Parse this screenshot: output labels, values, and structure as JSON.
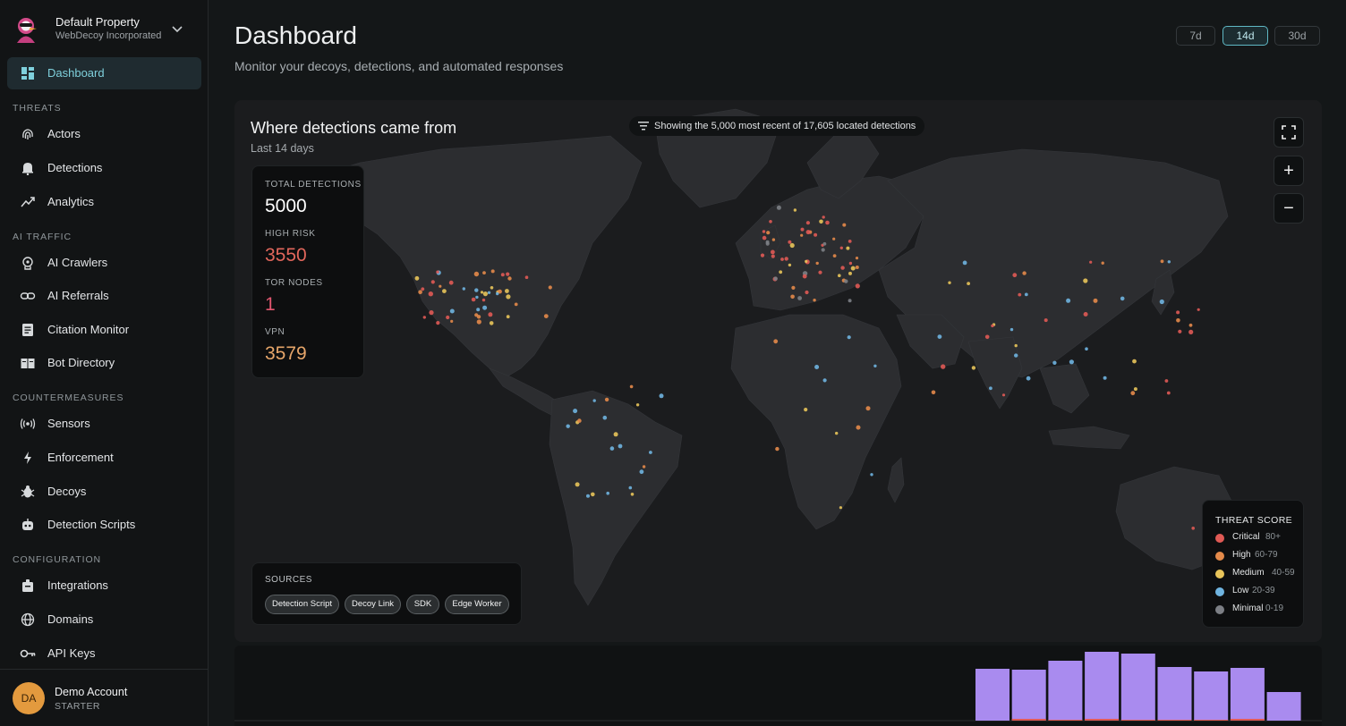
{
  "property": {
    "name": "Default Property",
    "org": "WebDecoy Incorporated"
  },
  "nav": {
    "dashboard": "Dashboard",
    "sections": {
      "threats": "THREATS",
      "ai_traffic": "AI TRAFFIC",
      "countermeasures": "COUNTERMEASURES",
      "configuration": "CONFIGURATION"
    },
    "items": {
      "actors": "Actors",
      "detections": "Detections",
      "analytics": "Analytics",
      "ai_crawlers": "AI Crawlers",
      "ai_referrals": "AI Referrals",
      "citation_monitor": "Citation Monitor",
      "bot_directory": "Bot Directory",
      "sensors": "Sensors",
      "enforcement": "Enforcement",
      "decoys": "Decoys",
      "detection_scripts": "Detection Scripts",
      "integrations": "Integrations",
      "domains": "Domains",
      "api_keys": "API Keys"
    }
  },
  "account": {
    "initials": "DA",
    "name": "Demo Account",
    "plan": "STARTER"
  },
  "header": {
    "title": "Dashboard",
    "subtitle": "Monitor your decoys, detections, and automated responses",
    "ranges": [
      "7d",
      "14d",
      "30d"
    ],
    "selected_range": "14d"
  },
  "map": {
    "title": "Where detections came from",
    "period": "Last 14 days",
    "showing": "Showing the 5,000 most recent of 17,605 located detections",
    "stats": {
      "total_label": "TOTAL DETECTIONS",
      "total": "5000",
      "high_risk_label": "HIGH RISK",
      "high_risk": "3550",
      "tor_label": "TOR NODES",
      "tor": "1",
      "vpn_label": "VPN",
      "vpn": "3579"
    },
    "sources": {
      "title": "SOURCES",
      "chips": [
        "Detection Script",
        "Decoy Link",
        "SDK",
        "Edge Worker"
      ]
    },
    "legend": {
      "title": "THREAT SCORE",
      "items": [
        {
          "name": "Critical",
          "range": "80+",
          "color": "#e05a55"
        },
        {
          "name": "High",
          "range": "60-79",
          "color": "#e48a4a"
        },
        {
          "name": "Medium",
          "range": "40-59",
          "color": "#e8c45a"
        },
        {
          "name": "Low",
          "range": "20-39",
          "color": "#6fb4e0"
        },
        {
          "name": "Minimal",
          "range": "0-19",
          "color": "#7c7f85"
        }
      ]
    },
    "controls": [
      "fullscreen-icon",
      "zoom-in-icon",
      "zoom-out-icon"
    ]
  },
  "timeline": {
    "bar_color": "#a98bef",
    "bars": [
      {
        "total": 58,
        "high": 0
      },
      {
        "total": 57,
        "high": 2
      },
      {
        "total": 67,
        "high": 1
      },
      {
        "total": 77,
        "high": 2
      },
      {
        "total": 75,
        "high": 1
      },
      {
        "total": 60,
        "high": 1
      },
      {
        "total": 55,
        "high": 1
      },
      {
        "total": 59,
        "high": 2
      },
      {
        "total": 32,
        "high": 0
      }
    ],
    "max": 80
  },
  "colors": {
    "accent": "#7fd0dc",
    "critical": "#e05a55",
    "high": "#e48a4a",
    "tor": "#e0566f",
    "vpn": "#e7a66a"
  }
}
